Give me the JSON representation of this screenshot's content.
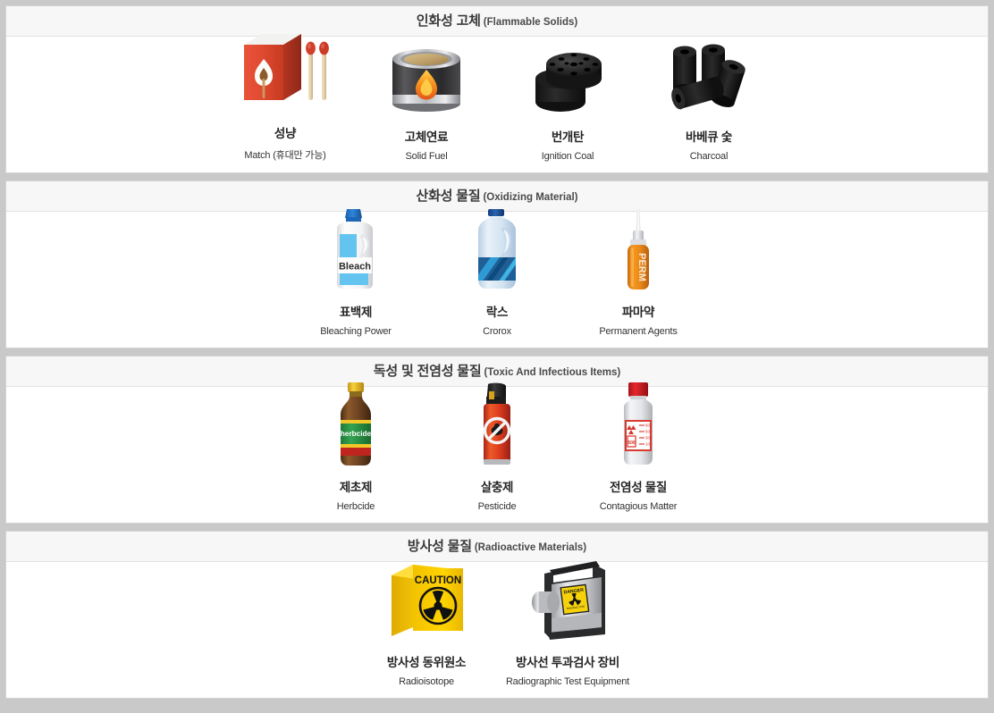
{
  "page": {
    "background_color": "#c9c9c9",
    "panel_background": "#ffffff",
    "header_background": "#f7f7f7",
    "border_color": "#d3d3d3"
  },
  "sections": [
    {
      "id": "flammable-solids",
      "title_ko": "인화성 고체",
      "title_en": "(Flammable Solids)",
      "items": [
        {
          "icon": "matchbox-icon",
          "label_ko": "성냥",
          "label_en": "Match (휴대만 가능)"
        },
        {
          "icon": "solid-fuel-can-icon",
          "label_ko": "고체연료",
          "label_en": "Solid Fuel"
        },
        {
          "icon": "ignition-coal-icon",
          "label_ko": "번개탄",
          "label_en": "Ignition Coal"
        },
        {
          "icon": "charcoal-icon",
          "label_ko": "바베큐 숯",
          "label_en": "Charcoal"
        }
      ]
    },
    {
      "id": "oxidizing-material",
      "title_ko": "산화성 물질",
      "title_en": "(Oxidizing Material)",
      "items": [
        {
          "icon": "bleach-bottle-icon",
          "label_ko": "표백제",
          "label_en": "Bleaching Power",
          "art_text": "Bleach"
        },
        {
          "icon": "crorox-bottle-icon",
          "label_ko": "락스",
          "label_en": "Crorox"
        },
        {
          "icon": "perm-agent-icon",
          "label_ko": "파마약",
          "label_en": "Permanent Agents",
          "art_text": "PERM"
        }
      ]
    },
    {
      "id": "toxic-infectious",
      "title_ko": "독성 및 전염성 물질",
      "title_en": "(Toxic And Infectious Items)",
      "items": [
        {
          "icon": "herbicide-bottle-icon",
          "label_ko": "제초제",
          "label_en": "Herbcide",
          "art_text": "herbcide"
        },
        {
          "icon": "pesticide-spray-icon",
          "label_ko": "살충제",
          "label_en": "Pesticide"
        },
        {
          "icon": "contagious-matter-bottle-icon",
          "label_ko": "전염성 물질",
          "label_en": "Contagious Matter"
        }
      ]
    },
    {
      "id": "radioactive-materials",
      "title_ko": "방사성 물질",
      "title_en": "(Radioactive Materials)",
      "items": [
        {
          "icon": "radioisotope-box-icon",
          "label_ko": "방사성 동위원소",
          "label_en": "Radioisotope",
          "art_text": "CAUTION"
        },
        {
          "icon": "radiographic-equipment-icon",
          "label_ko": "방사선 투과검사 장비",
          "label_en": "Radiographic Test Equipment",
          "art_text": "DANGER"
        }
      ]
    }
  ]
}
